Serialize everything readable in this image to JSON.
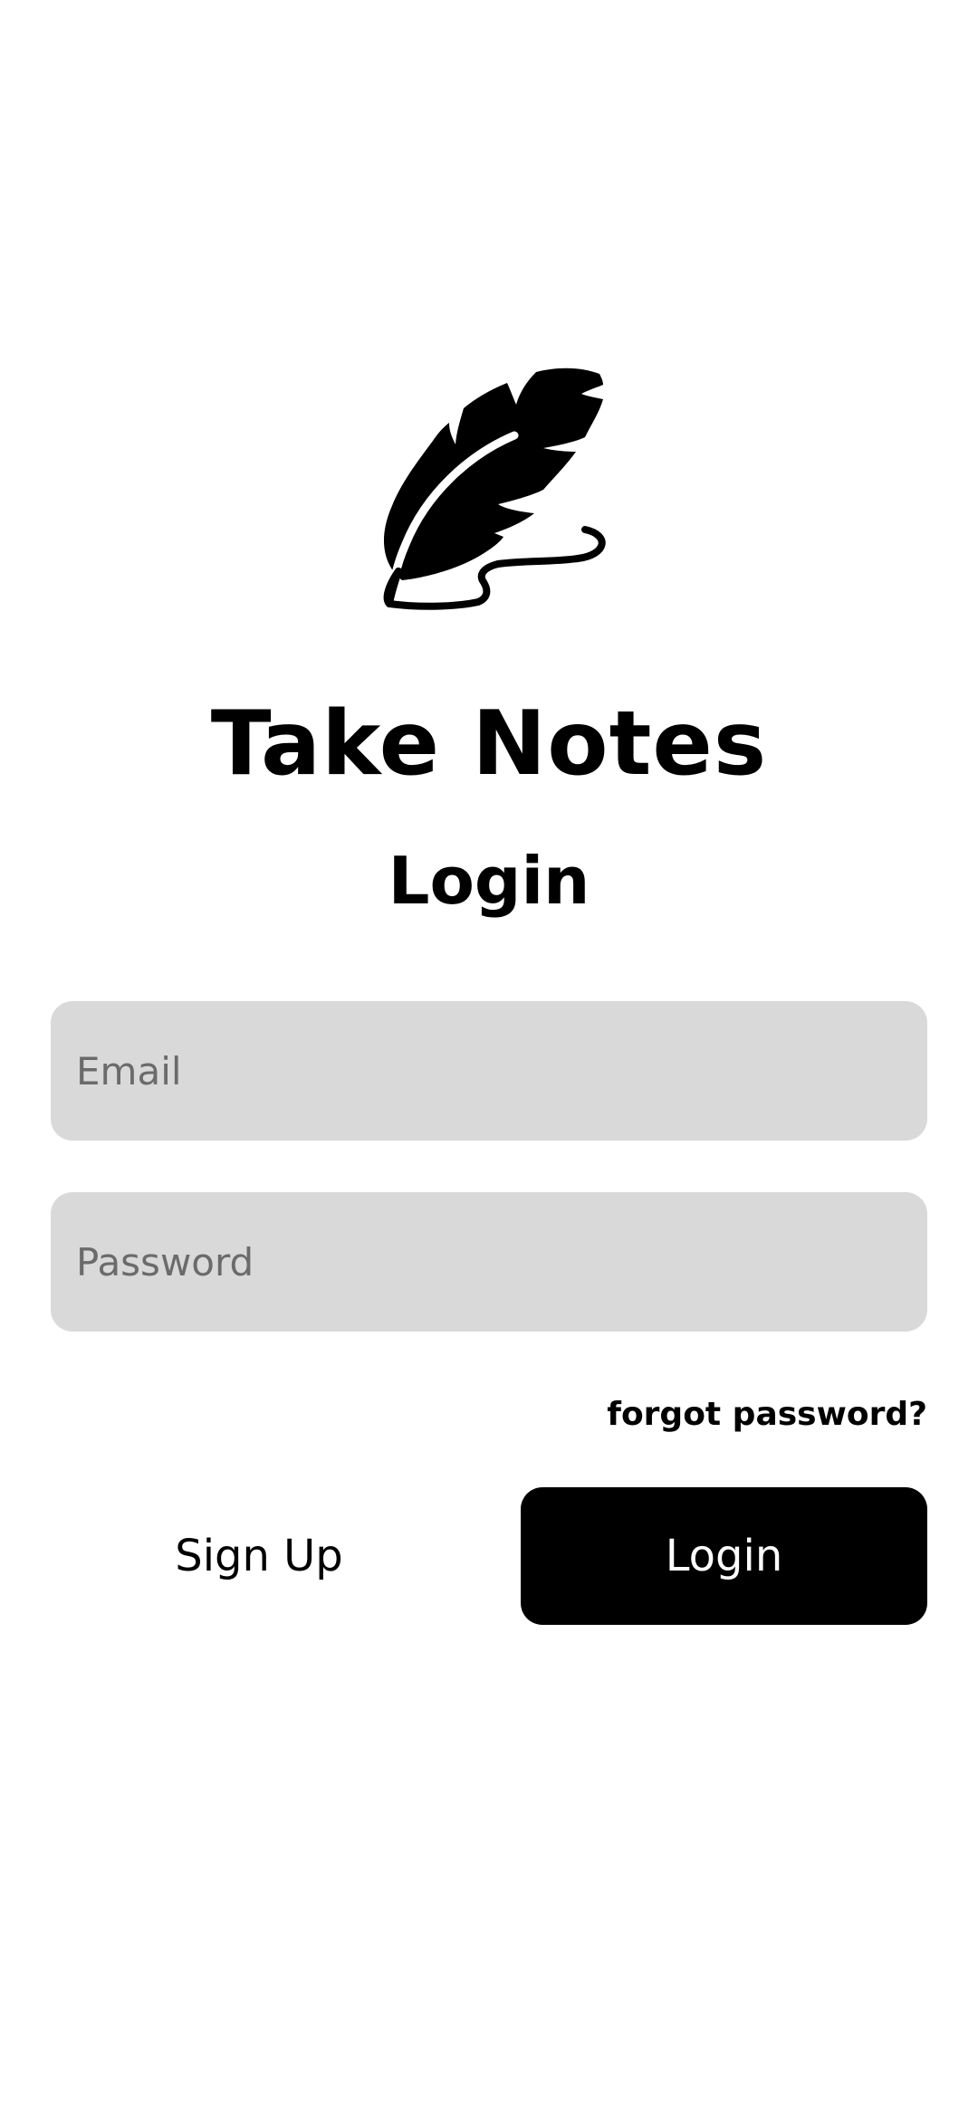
{
  "logo": {
    "icon": "quill-feather-icon"
  },
  "app_title": "Take Notes",
  "screen_title": "Login",
  "form": {
    "email": {
      "value": "",
      "placeholder": "Email"
    },
    "password": {
      "value": "",
      "placeholder": "Password"
    },
    "forgot_label": "forgot password?"
  },
  "actions": {
    "signup_label": "Sign Up",
    "login_label": "Login"
  },
  "colors": {
    "background": "#ffffff",
    "field_bg": "#d9d9d9",
    "placeholder": "#6b6b6b",
    "primary": "#000000",
    "primary_text": "#ffffff"
  }
}
